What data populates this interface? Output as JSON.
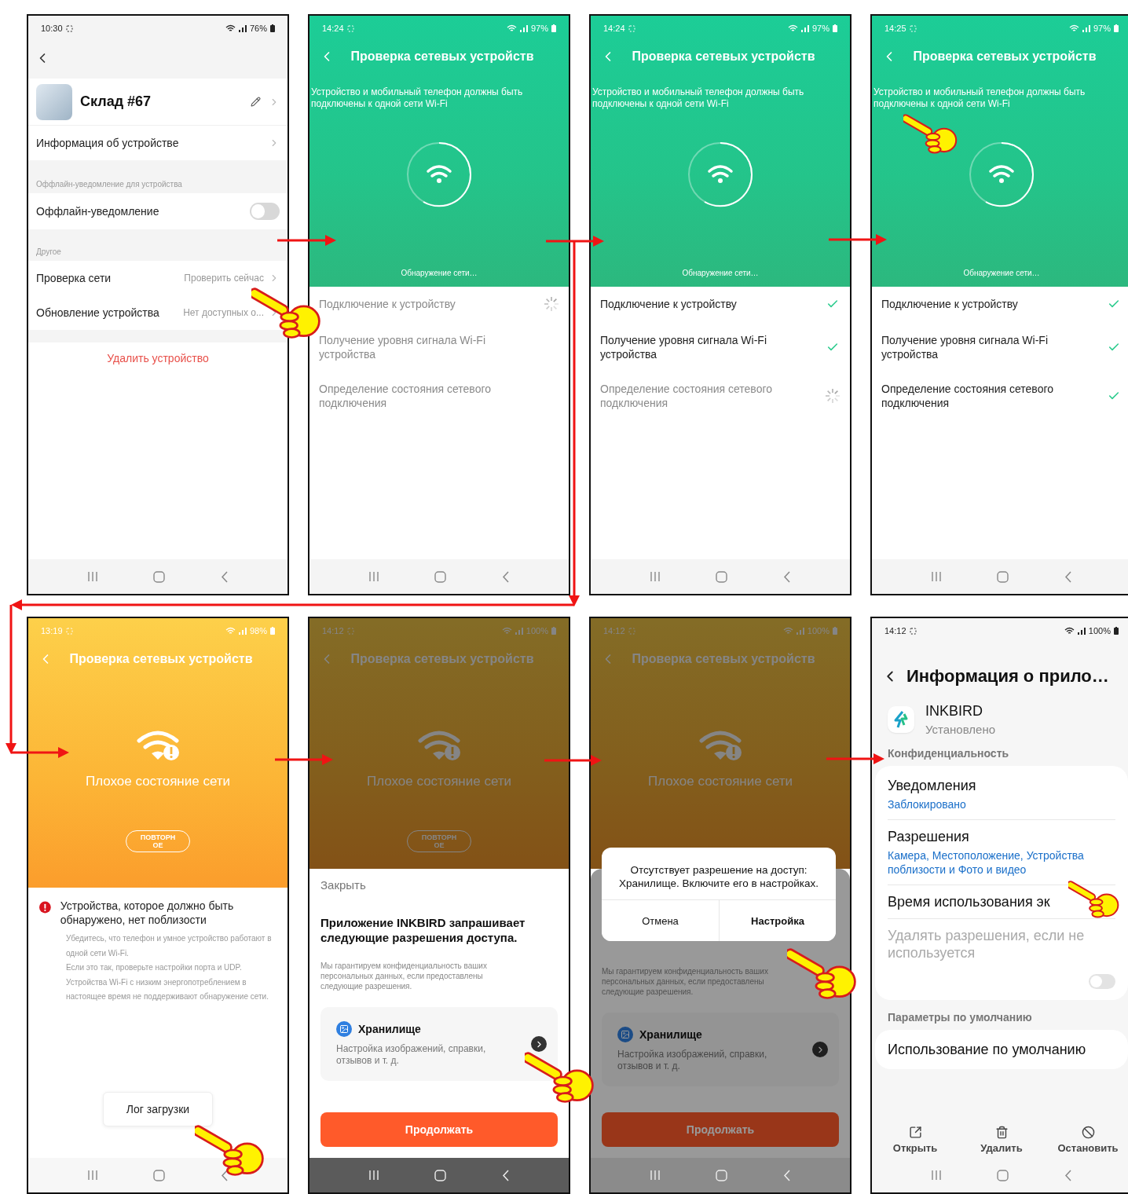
{
  "screens": [
    {
      "kind": "device_settings",
      "time": "10:30",
      "battery": "76%",
      "device_name": "Склад #67",
      "info_row": "Информация об устройстве",
      "offline_section": "Оффлайн-уведомление для устройства",
      "offline_toggle": {
        "label": "Оффлайн-уведомление",
        "on": false
      },
      "other_section": "Другое",
      "rows": [
        {
          "label": "Проверка сети",
          "value": "Проверить сейчас"
        },
        {
          "label": "Обновление устройства",
          "value": "Нет доступных о..."
        }
      ],
      "delete": "Удалить устройство"
    },
    {
      "kind": "scan",
      "time": "14:24",
      "battery": "97%",
      "title": "Проверка сетевых устройств",
      "notice": "Устройство и мобильный телефон должны быть подключены к одной сети Wi-Fi",
      "status": "Обнаружение сети…",
      "steps": [
        {
          "label": "Подключение к устройству",
          "done": false,
          "loading": true
        },
        {
          "label": "Получение уровня сигнала Wi-Fi устройства",
          "done": false,
          "loading": false
        },
        {
          "label": "Определение состояния сетевого подключения",
          "done": false,
          "loading": false
        }
      ]
    },
    {
      "kind": "scan",
      "time": "14:24",
      "battery": "97%",
      "title": "Проверка сетевых устройств",
      "notice": "Устройство и мобильный телефон должны быть подключены к одной сети Wi-Fi",
      "status": "Обнаружение сети…",
      "steps": [
        {
          "label": "Подключение к устройству",
          "done": true,
          "loading": false
        },
        {
          "label": "Получение уровня сигнала Wi-Fi устройства",
          "done": true,
          "loading": false
        },
        {
          "label": "Определение состояния сетевого подключения",
          "done": false,
          "loading": true
        }
      ]
    },
    {
      "kind": "scan",
      "time": "14:25",
      "battery": "97%",
      "title": "Проверка сетевых устройств",
      "notice": "Устройство и мобильный телефон должны быть подключены к одной сети Wi-Fi",
      "status": "Обнаружение сети…",
      "steps": [
        {
          "label": "Подключение к устройству",
          "done": true,
          "loading": false
        },
        {
          "label": "Получение уровня сигнала Wi-Fi устройства",
          "done": true,
          "loading": false
        },
        {
          "label": "Определение состояния сетевого подключения",
          "done": true,
          "loading": false
        }
      ]
    },
    {
      "kind": "result",
      "time": "13:19",
      "battery": "98%",
      "dimmed": false,
      "title": "Проверка сетевых устройств",
      "result": "Плохое состояние сети",
      "retry": "ПОВТОРНОЕ",
      "error_title": "Устройства, которое должно быть обнаружено, нет поблизости",
      "error_text": [
        "Убедитесь, что телефон и умное устройство работают в одной сети Wi-Fi.",
        "Если это так, проверьте настройки порта и UDP.",
        "Устройства Wi-Fi с низким энергопотреблением в настоящее время не поддерживают обнаружение сети."
      ],
      "log_button": "Лог загрузки"
    },
    {
      "kind": "result",
      "time": "14:12",
      "battery": "100%",
      "dimmed": true,
      "title": "Проверка сетевых устройств",
      "result": "Плохое состояние сети",
      "retry": "ПОВТОРНОЕ",
      "sheet": {
        "dimmed": false,
        "close": "Закрыть",
        "heading": "Приложение INKBIRD запрашивает следующие разрешения доступа.",
        "note": "Мы гарантируем конфиденциальность ваших персональных данных, если предоставлены следующие разрешения.",
        "permission": {
          "name": "Хранилище",
          "description": "Настройка изображений, справки, отзывов и т. д."
        },
        "continue": "Продолжать"
      }
    },
    {
      "kind": "result",
      "time": "14:12",
      "battery": "100%",
      "dimmed": true,
      "title": "Проверка сетевых устройств",
      "result": "Плохое состояние сети",
      "sheet": {
        "dimmed": true,
        "note": "Мы гарантируем конфиденциальность ваших персональных данных, если предоставлены следующие разрешения.",
        "permission": {
          "name": "Хранилище",
          "description": "Настройка изображений, справки, отзывов и т. д."
        },
        "continue": "Продолжать"
      },
      "dialog": {
        "message": "Отсутствует разрешение на доступ: Хранилище. Включите его в настройках.",
        "buttons": [
          {
            "label": "Отмена",
            "primary": false
          },
          {
            "label": "Настройка",
            "primary": true
          }
        ]
      }
    },
    {
      "kind": "app_info",
      "time": "14:12",
      "battery": "100%",
      "title": "Информация о прило…",
      "app_name": "INKBIRD",
      "app_status": "Установлено",
      "privacy_section": "Конфиденциальность",
      "items": [
        {
          "title": "Уведомления",
          "subtitle": "Заблокировано"
        },
        {
          "title": "Разрешения",
          "subtitle": "Камера, Местоположение, Устройства поблизости и Фото и видео"
        },
        {
          "title": "Время использования эк"
        }
      ],
      "auto_revoke": {
        "label": "Удалять разрешения, если не используется",
        "on": false,
        "disabled": true
      },
      "defaults_section": "Параметры по умолчанию",
      "defaults_item": "Использование по умолчанию",
      "actions": [
        {
          "kind": "open",
          "label": "Открыть"
        },
        {
          "kind": "delete",
          "label": "Удалить"
        },
        {
          "kind": "stop",
          "label": "Остановить"
        }
      ]
    }
  ]
}
